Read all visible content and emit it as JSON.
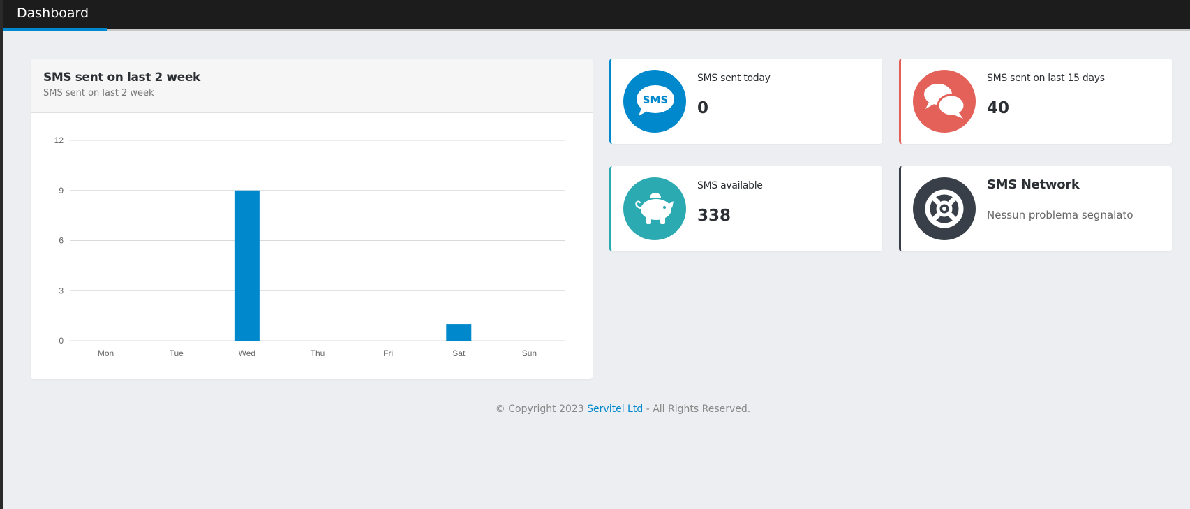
{
  "header": {
    "title": "Dashboard"
  },
  "chart_card": {
    "title": "SMS sent on last 2 week",
    "subtitle": "SMS sent on last 2 week"
  },
  "chart_data": {
    "type": "bar",
    "categories": [
      "Mon",
      "Tue",
      "Wed",
      "Thu",
      "Fri",
      "Sat",
      "Sun"
    ],
    "values": [
      0,
      0,
      9,
      0,
      0,
      1,
      0
    ],
    "yticks": [
      0,
      3,
      6,
      9,
      12
    ],
    "ylim": [
      0,
      12
    ],
    "grid": true,
    "color": "#0088cc"
  },
  "stats": {
    "today": {
      "label": "SMS sent today",
      "value": "0",
      "icon": "sms-bubble-icon",
      "color": "#0088cc"
    },
    "last15": {
      "label": "SMS sent on last 15 days",
      "value": "40",
      "icon": "chat-bubbles-icon",
      "color": "#e36159"
    },
    "available": {
      "label": "SMS available",
      "value": "338",
      "icon": "piggy-bank-icon",
      "color": "#2baab1"
    },
    "network": {
      "label": "SMS Network",
      "value": "Nessun problema segnalato",
      "icon": "life-ring-icon",
      "color": "#383f48"
    }
  },
  "footer": {
    "prefix": "© Copyright 2023",
    "link": "Servitel Ltd",
    "suffix": "- All Rights Reserved."
  }
}
